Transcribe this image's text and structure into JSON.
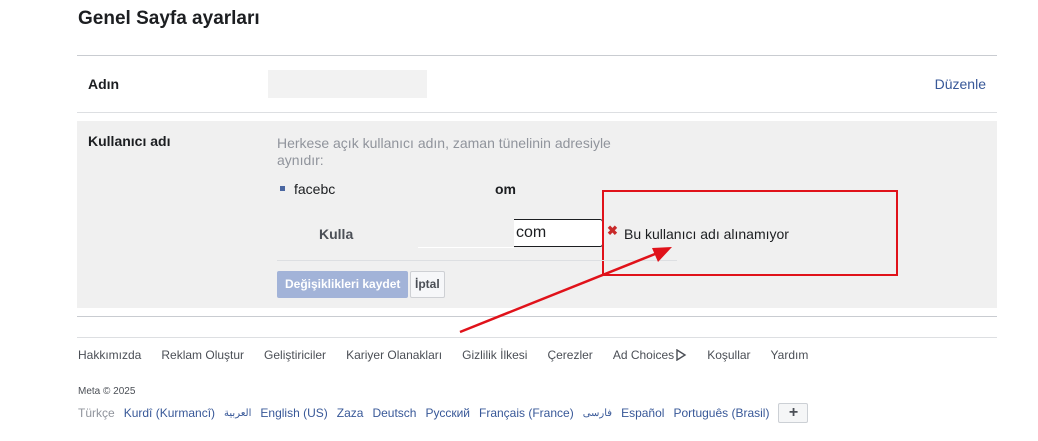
{
  "page": {
    "title": "Genel Sayfa ayarları"
  },
  "name_row": {
    "label": "Adın",
    "edit": "Düzenle"
  },
  "username_row": {
    "label": "Kullanıcı adı",
    "description": "Herkese açık kullanıcı adın, zaman tünelinin adresiyle aynıdır:",
    "url_start": "facebc",
    "url_end": "om",
    "field_label": "Kulla",
    "input_value": "com",
    "error": "Bu kullanıcı adı alınamıyor",
    "save": "Değişiklikleri kaydet",
    "cancel": "İptal"
  },
  "footer": {
    "links": [
      "Hakkımızda",
      "Reklam Oluştur",
      "Geliştiriciler",
      "Kariyer Olanakları",
      "Gizlilik İlkesi",
      "Çerezler",
      "Ad Choices",
      "Koşullar",
      "Yardım"
    ],
    "copyright": "Meta © 2025",
    "current_language": "Türkçe",
    "languages": [
      "Kurdî (Kurmancî)",
      "العربية",
      "English (US)",
      "Zaza",
      "Deutsch",
      "Русский",
      "Français (France)",
      "فارسی",
      "Español",
      "Português (Brasil)"
    ],
    "more": "+"
  },
  "colors": {
    "link": "#385898",
    "annotation": "#e0121a",
    "panel": "#f0f0f0"
  }
}
